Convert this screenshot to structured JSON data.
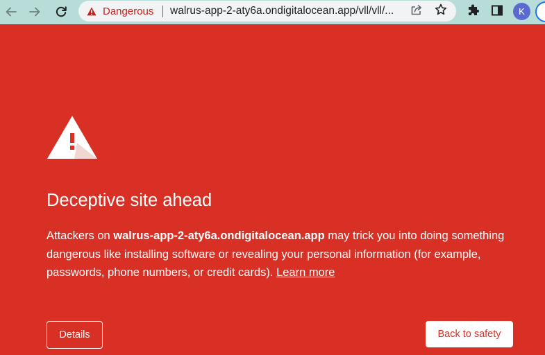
{
  "browser": {
    "security_label": "Dangerous",
    "url": "walrus-app-2-aty6a.ondigitalocean.app/vll/vll/...",
    "profile_initial": "K",
    "icons": {
      "back": "arrow-left-icon",
      "forward": "arrow-right-icon",
      "reload": "reload-icon",
      "security": "warning-triangle-icon",
      "share": "share-icon",
      "bookmark": "star-icon",
      "extensions": "puzzle-icon",
      "side_panel": "side-panel-icon"
    }
  },
  "interstitial": {
    "heading": "Deceptive site ahead",
    "message_prefix": "Attackers on ",
    "domain": "walrus-app-2-aty6a.ondigitalocean.app",
    "message_suffix": " may trick you into doing something dangerous like installing software or revealing your personal information (for example, passwords, phone numbers, or credit cards). ",
    "learn_more": "Learn more",
    "details_button": "Details",
    "back_button": "Back to safety"
  },
  "colors": {
    "danger_background": "#d93025",
    "toolbar_background": "#b8dcd8",
    "omnibox_background": "#f1f3f4",
    "danger_text": "#c5221f",
    "avatar": "#5b6ad0",
    "focus_ring": "#1a73e8"
  }
}
